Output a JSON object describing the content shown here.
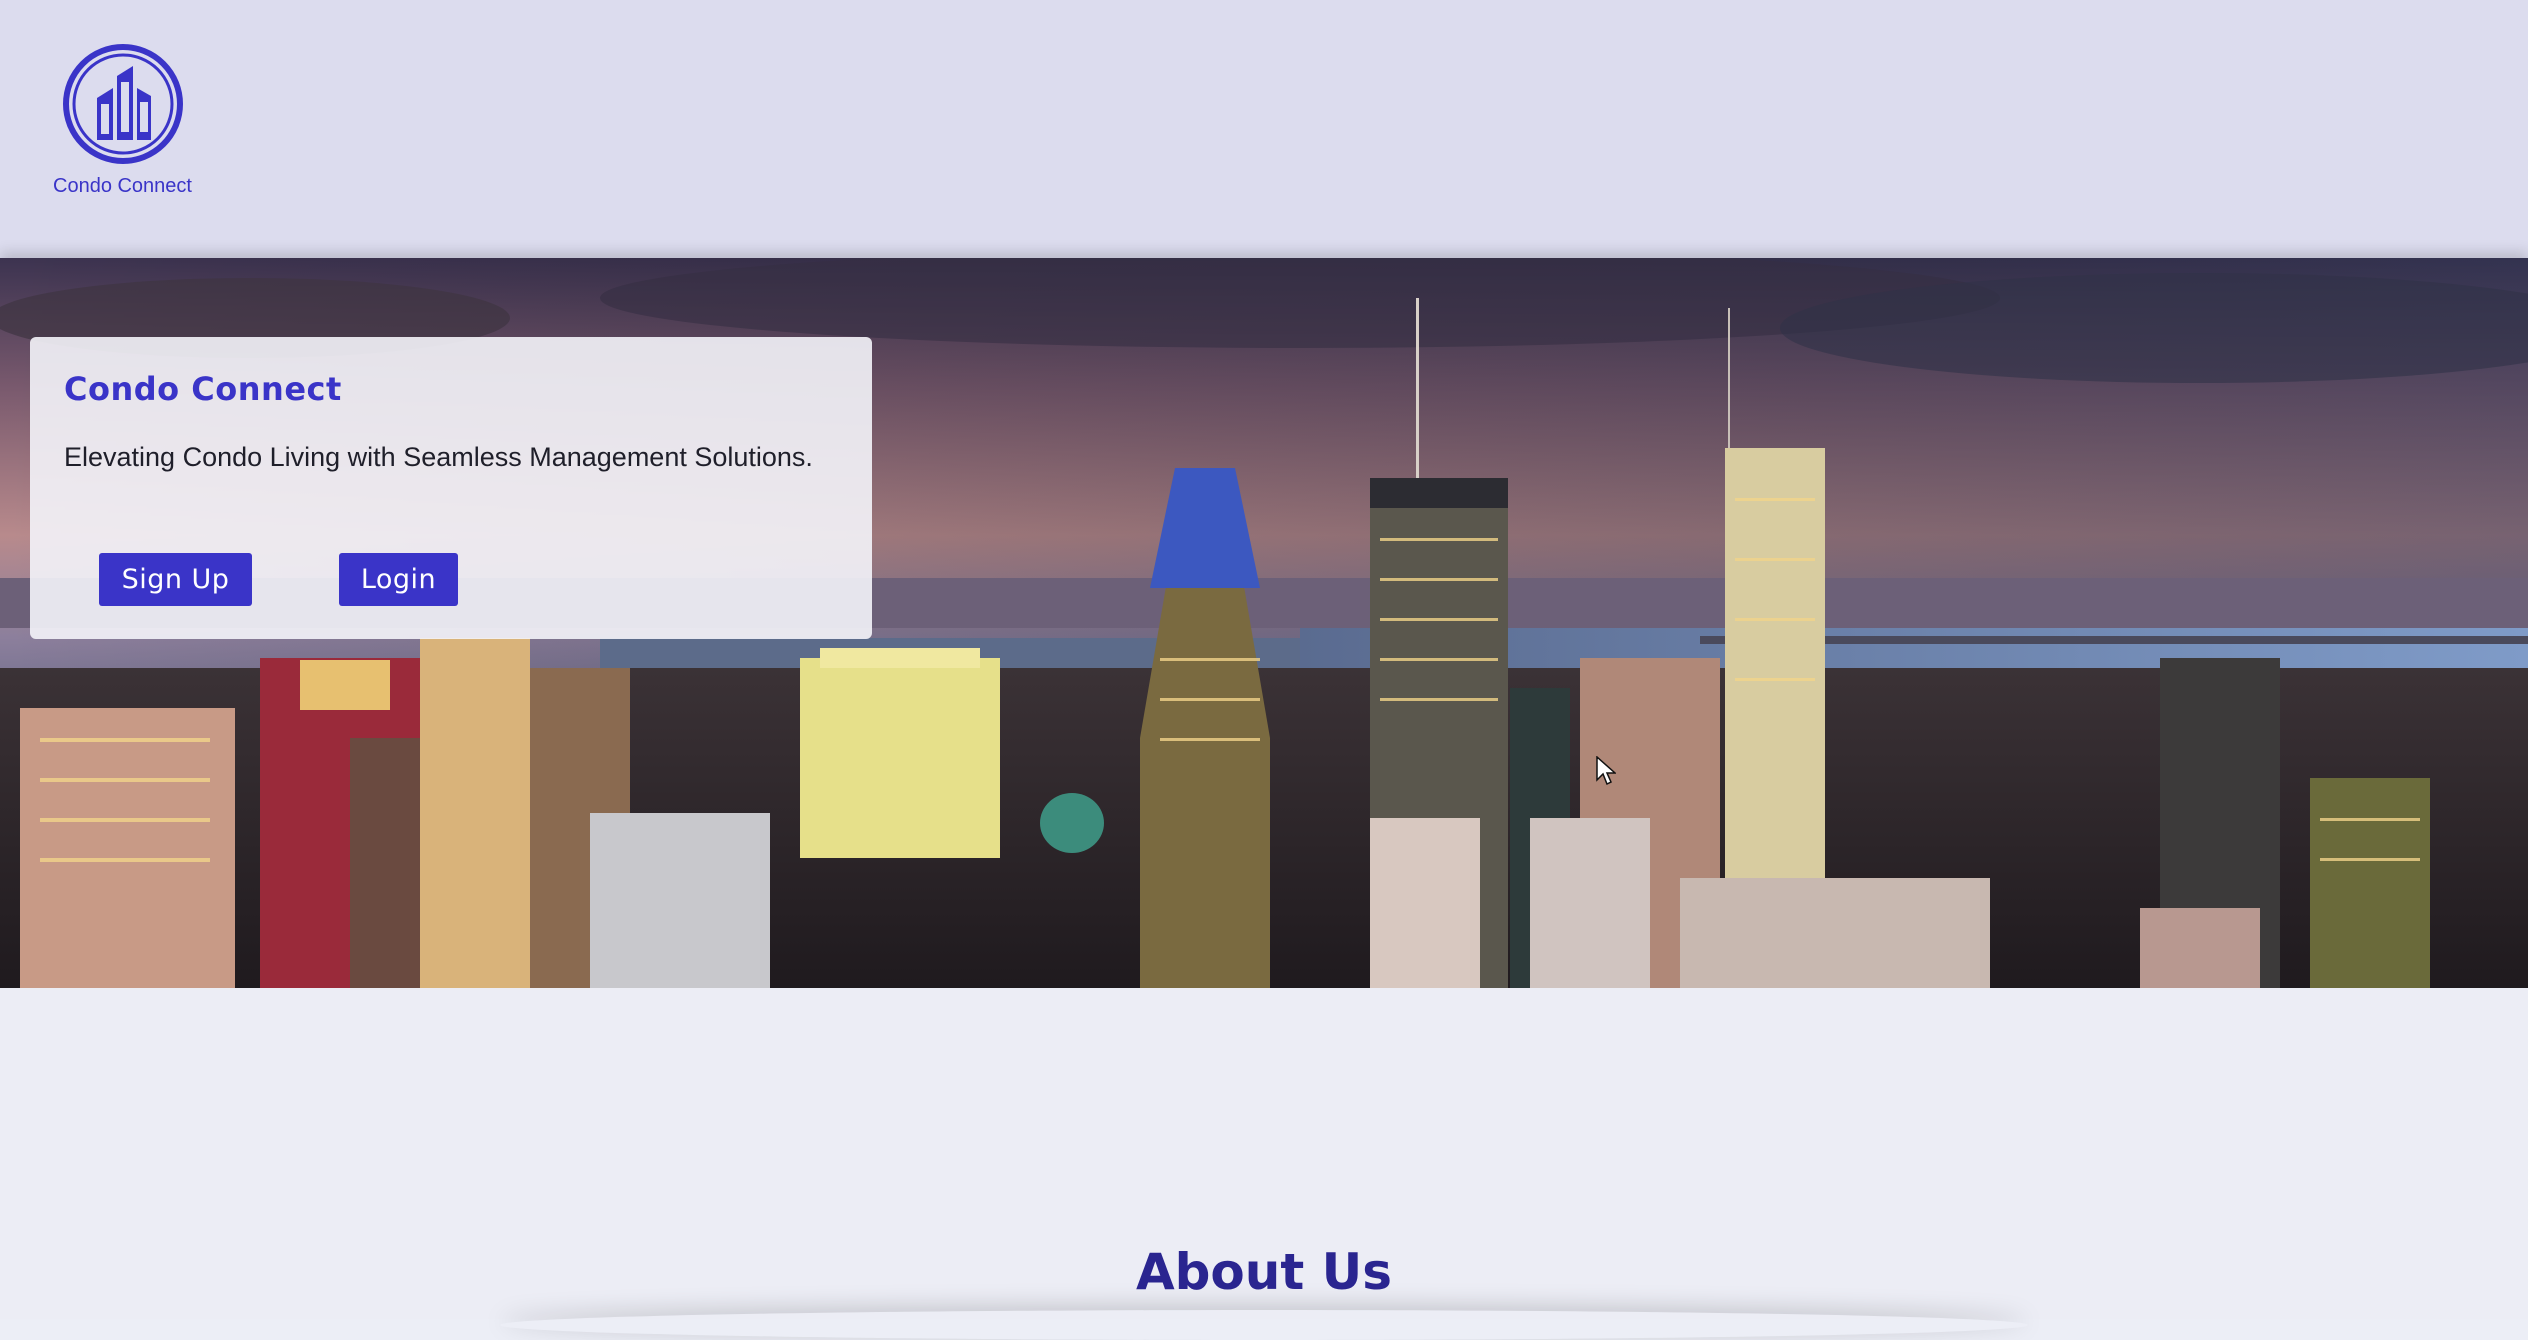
{
  "header": {
    "logo_icon": "building-circle-icon",
    "logo_text": "Condo Connect"
  },
  "hero": {
    "background": "city-skyline-at-dusk-image",
    "card": {
      "title": "Condo Connect",
      "tagline": "Elevating Condo Living with Seamless Management Solutions.",
      "signup_label": "Sign Up",
      "login_label": "Login"
    }
  },
  "about": {
    "title": "About Us"
  },
  "colors": {
    "accent": "#3a34c8",
    "header_bg": "#dcdcee",
    "page_bg": "#ecedf5",
    "about_title": "#2a2590"
  }
}
